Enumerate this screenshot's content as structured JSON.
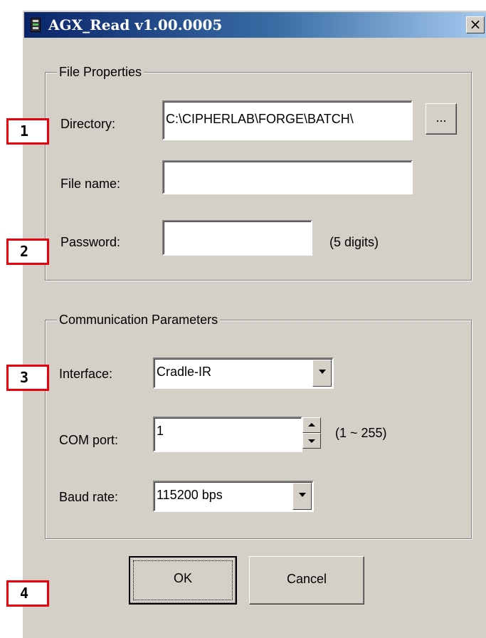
{
  "window": {
    "title": "AGX_Read v1.00.0005",
    "close_label": "×",
    "icon": "app-icon"
  },
  "file_properties": {
    "group_label": "File Properties",
    "directory_label": "Directory:",
    "directory_value": "C:\\CIPHERLAB\\FORGE\\BATCH\\",
    "browse_label": "...",
    "filename_label": "File name:",
    "filename_value": "",
    "password_label": "Password:",
    "password_value": "",
    "password_hint": "(5 digits)"
  },
  "communication": {
    "group_label": "Communication Parameters",
    "interface_label": "Interface:",
    "interface_value": "Cradle-IR",
    "com_port_label": "COM port:",
    "com_port_value": "1",
    "com_port_range": "(1 ~ 255)",
    "baud_rate_label": "Baud rate:",
    "baud_rate_value": "115200 bps"
  },
  "buttons": {
    "ok_label": "OK",
    "cancel_label": "Cancel"
  },
  "markers": [
    "1",
    "2",
    "3",
    "4"
  ],
  "colors": {
    "title_gradient_start": "#0a246a",
    "title_gradient_end": "#a6caf0",
    "dialog_face": "#d4d0c8",
    "marker_border": "#e8000a"
  }
}
